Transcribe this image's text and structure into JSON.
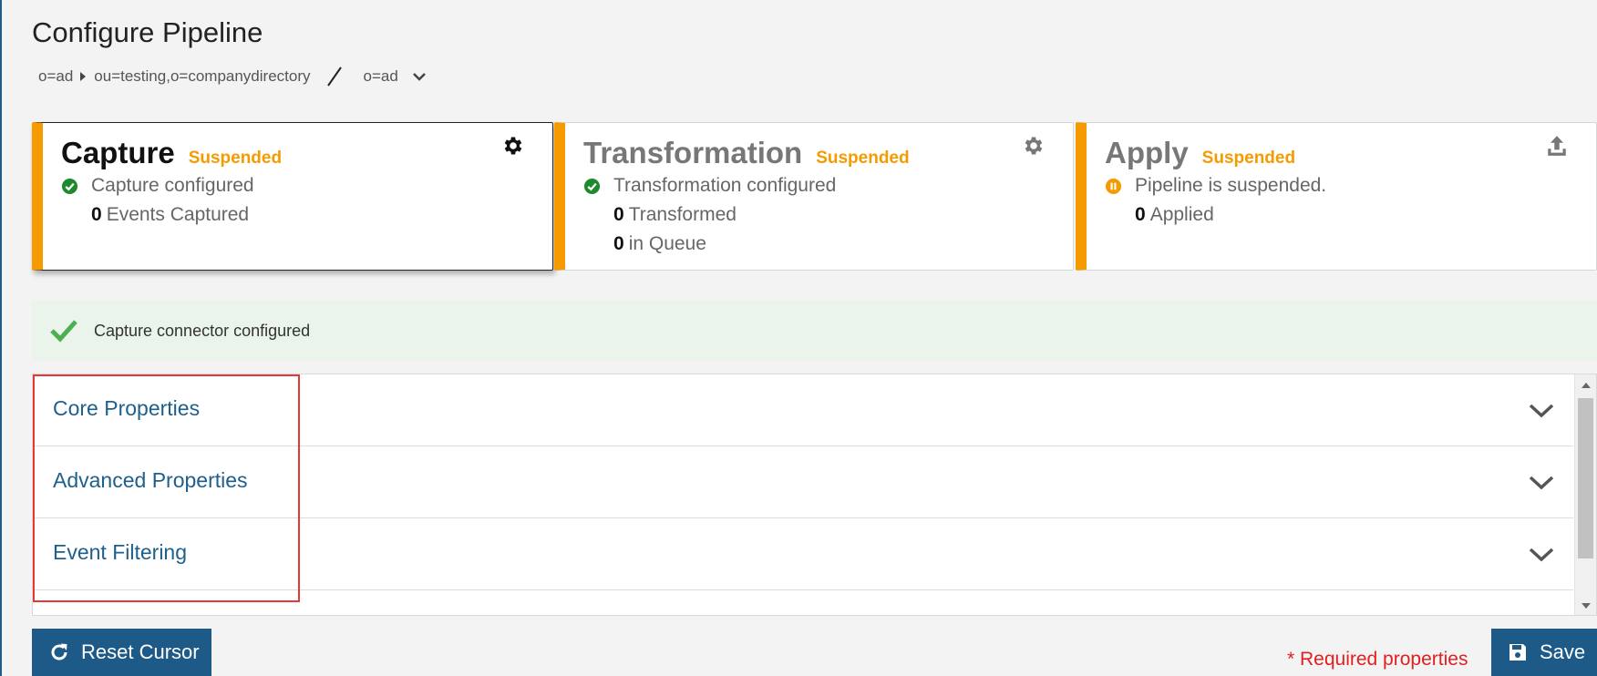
{
  "page": {
    "title": "Configure Pipeline"
  },
  "breadcrumb": {
    "items": [
      "o=ad",
      "ou=testing,o=companydirectory"
    ],
    "current": "o=ad"
  },
  "stages": [
    {
      "title": "Capture",
      "status": "Suspended",
      "status_text": "Capture configured",
      "status_icon": "check-circle-icon",
      "action_icon": "gear-icon",
      "counts": [
        {
          "value": "0",
          "label": "Events Captured"
        }
      ]
    },
    {
      "title": "Transformation",
      "status": "Suspended",
      "status_text": "Transformation configured",
      "status_icon": "check-circle-icon",
      "action_icon": "gear-icon",
      "counts": [
        {
          "value": "0",
          "label": "Transformed"
        },
        {
          "value": "0",
          "label": "in Queue"
        }
      ]
    },
    {
      "title": "Apply",
      "status": "Suspended",
      "status_text": "Pipeline is suspended.",
      "status_icon": "pause-circle-icon",
      "action_icon": "upload-icon",
      "counts": [
        {
          "value": "0",
          "label": "Applied"
        }
      ]
    }
  ],
  "alert": {
    "message": "Capture connector configured"
  },
  "accordion": {
    "sections": [
      "Core Properties",
      "Advanced Properties",
      "Event Filtering"
    ]
  },
  "footer": {
    "reset_label": "Reset Cursor",
    "required_note": "* Required properties",
    "save_label": "Save"
  },
  "colors": {
    "accent_orange": "#f59b00",
    "primary_blue": "#1d5a87",
    "link_blue": "#1f5f8b",
    "success_green": "#1e8a2e",
    "alert_bg": "#eaf4ea",
    "required_red": "#e02020",
    "highlight_red": "#e53935"
  }
}
